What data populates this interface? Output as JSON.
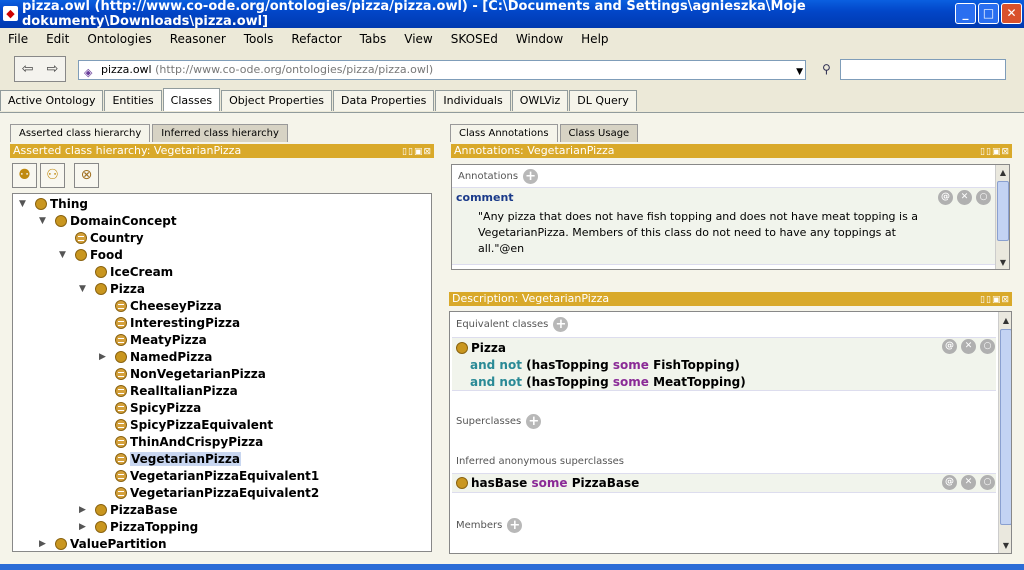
{
  "window": {
    "title": "pizza.owl (http://www.co-ode.org/ontologies/pizza/pizza.owl) - [C:\\Documents and Settings\\agnieszka\\Moje dokumenty\\Downloads\\pizza.owl]",
    "min": "_",
    "max": "□",
    "close": "✕"
  },
  "menu": [
    "File",
    "Edit",
    "Ontologies",
    "Reasoner",
    "Tools",
    "Refactor",
    "Tabs",
    "View",
    "SKOSEd",
    "Window",
    "Help"
  ],
  "address": {
    "name": "pizza.owl",
    "uri": "(http://www.co-ode.org/ontologies/pizza/pizza.owl)",
    "back": "⇦",
    "forward": "⇨",
    "search_value": ""
  },
  "tabs": [
    "Active Ontology",
    "Entities",
    "Classes",
    "Object Properties",
    "Data Properties",
    "Individuals",
    "OWLViz",
    "DL Query"
  ],
  "active_tab": "Classes",
  "left": {
    "subtabs": [
      "Asserted class hierarchy",
      "Inferred class hierarchy"
    ],
    "header": "Asserted class hierarchy: VegetarianPizza",
    "tree": [
      {
        "label": "Thing",
        "level": 0,
        "toggle": "▼",
        "type": "class"
      },
      {
        "label": "DomainConcept",
        "level": 1,
        "toggle": "▼",
        "type": "class"
      },
      {
        "label": "Country",
        "level": 2,
        "toggle": "",
        "type": "eq"
      },
      {
        "label": "Food",
        "level": 2,
        "toggle": "▼",
        "type": "class"
      },
      {
        "label": "IceCream",
        "level": 3,
        "toggle": "",
        "type": "class"
      },
      {
        "label": "Pizza",
        "level": 3,
        "toggle": "▼",
        "type": "class"
      },
      {
        "label": "CheeseyPizza",
        "level": 4,
        "toggle": "",
        "type": "eq"
      },
      {
        "label": "InterestingPizza",
        "level": 4,
        "toggle": "",
        "type": "eq"
      },
      {
        "label": "MeatyPizza",
        "level": 4,
        "toggle": "",
        "type": "eq"
      },
      {
        "label": "NamedPizza",
        "level": 4,
        "toggle": "▶",
        "type": "class"
      },
      {
        "label": "NonVegetarianPizza",
        "level": 4,
        "toggle": "",
        "type": "eq"
      },
      {
        "label": "RealItalianPizza",
        "level": 4,
        "toggle": "",
        "type": "eq"
      },
      {
        "label": "SpicyPizza",
        "level": 4,
        "toggle": "",
        "type": "eq"
      },
      {
        "label": "SpicyPizzaEquivalent",
        "level": 4,
        "toggle": "",
        "type": "eq"
      },
      {
        "label": "ThinAndCrispyPizza",
        "level": 4,
        "toggle": "",
        "type": "eq"
      },
      {
        "label": "VegetarianPizza",
        "level": 4,
        "toggle": "",
        "type": "eq",
        "selected": true
      },
      {
        "label": "VegetarianPizzaEquivalent1",
        "level": 4,
        "toggle": "",
        "type": "eq"
      },
      {
        "label": "VegetarianPizzaEquivalent2",
        "level": 4,
        "toggle": "",
        "type": "eq"
      },
      {
        "label": "PizzaBase",
        "level": 3,
        "toggle": "▶",
        "type": "class"
      },
      {
        "label": "PizzaTopping",
        "level": 3,
        "toggle": "▶",
        "type": "class"
      },
      {
        "label": "ValuePartition",
        "level": 1,
        "toggle": "▶",
        "type": "class"
      }
    ]
  },
  "right": {
    "subtabs": [
      "Class Annotations",
      "Class Usage"
    ],
    "annotations": {
      "header": "Annotations: VegetarianPizza",
      "section": "Annotations",
      "property": "comment",
      "text_lines": [
        "\"Any pizza that does not have fish topping and does not have meat topping is a",
        "VegetarianPizza. Members of this class do not need to have any toppings at",
        "all.\"@en"
      ]
    },
    "description": {
      "header": "Description: VegetarianPizza",
      "equivalent_label": "Equivalent classes",
      "eq_class": "Pizza",
      "eq_line1": {
        "and": "and",
        "not": "not",
        "open": "(hasTopping",
        "some": "some",
        "rest": "FishTopping)"
      },
      "eq_line2": {
        "and": "and",
        "not": "not",
        "open": "(hasTopping",
        "some": "some",
        "rest": "MeatTopping)"
      },
      "superclasses_label": "Superclasses",
      "inferred_label": "Inferred anonymous superclasses",
      "inferred": {
        "prop": "hasBase",
        "some": "some",
        "filler": "PizzaBase"
      },
      "members_label": "Members"
    }
  },
  "icons": {
    "plus": "+",
    "at": "@",
    "x": "✕",
    "o": "○"
  }
}
